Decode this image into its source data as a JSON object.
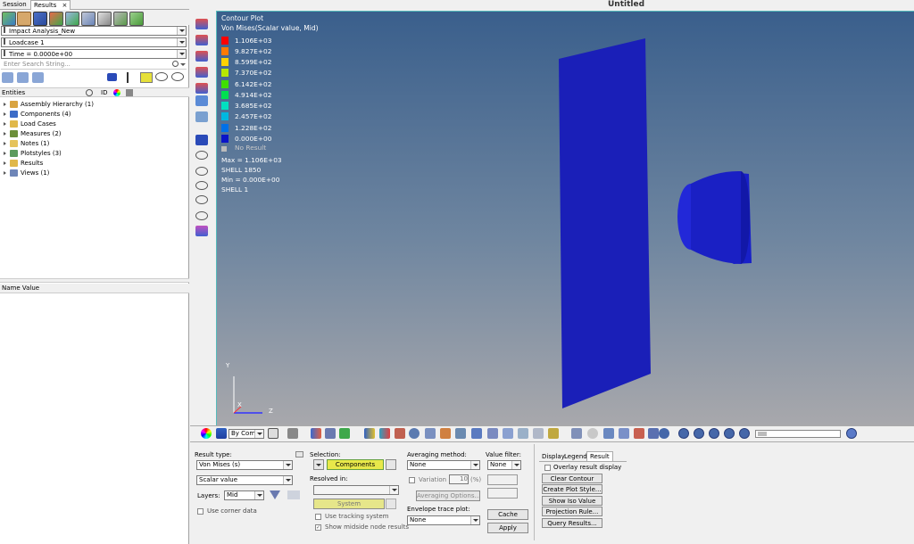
{
  "window": {
    "title": "Untitled"
  },
  "tabs": [
    {
      "label": "Session"
    },
    {
      "label": "Results"
    }
  ],
  "tab_close": "×",
  "dropdowns": {
    "model": "Impact Analysis_New",
    "loadcase": "Loadcase 1",
    "time": "Time = 0.0000e+00"
  },
  "search": {
    "placeholder": "Enter Search String..."
  },
  "entities": {
    "header": "Entities",
    "id_header": "ID"
  },
  "tree": [
    {
      "label": "Assembly Hierarchy (1)",
      "color": "#d9a441"
    },
    {
      "label": "Components (4)",
      "color": "#3c6cc8"
    },
    {
      "label": "Load Cases",
      "color": "#e0b84a"
    },
    {
      "label": "Measures (2)",
      "color": "#6c8f3a"
    },
    {
      "label": "Notes (1)",
      "color": "#e5c35b"
    },
    {
      "label": "Plotstyles (3)",
      "color": "#5d9b5d"
    },
    {
      "label": "Results",
      "color": "#e0b84a"
    },
    {
      "label": "Views (1)",
      "color": "#6f86b8"
    }
  ],
  "name_value_header": "Name Value",
  "legend": {
    "title": "Contour Plot",
    "subtitle": "Von Mises(Scalar value, Mid)",
    "levels": [
      {
        "value": "1.106E+03",
        "color": "#ff0000"
      },
      {
        "value": "9.827E+02",
        "color": "#ff7a00"
      },
      {
        "value": "8.599E+02",
        "color": "#ffd200"
      },
      {
        "value": "7.370E+02",
        "color": "#b8e800"
      },
      {
        "value": "6.142E+02",
        "color": "#3fe000"
      },
      {
        "value": "4.914E+02",
        "color": "#00e050"
      },
      {
        "value": "3.685E+02",
        "color": "#00e0c0"
      },
      {
        "value": "2.457E+02",
        "color": "#00b8e0"
      },
      {
        "value": "1.228E+02",
        "color": "#0070e8"
      },
      {
        "value": "0.000E+00",
        "color": "#0a14c8"
      }
    ],
    "no_result": "No Result",
    "max_line": "Max = 1.106E+03",
    "max_elem": "SHELL 1850",
    "min_line": "Min = 0.000E+00",
    "min_elem": "SHELL 1"
  },
  "axes": {
    "y": "Y",
    "x": "X",
    "z": "Z"
  },
  "toolbar": {
    "by_comp": "By Comp"
  },
  "result_panel": {
    "result_type_label": "Result type:",
    "result_type_value": "Von Mises (s)",
    "scalar_value": "Scalar value",
    "layers_label": "Layers:",
    "layers_value": "Mid",
    "use_corner_data": "Use corner data",
    "selection_label": "Selection:",
    "selection_value": "Components",
    "resolved_in_label": "Resolved in:",
    "system_button": "System",
    "use_tracking": "Use tracking system",
    "show_midside": "Show midside node results",
    "averaging_label": "Averaging method:",
    "averaging_value": "None",
    "variation_label": "Variation <",
    "variation_value": "10",
    "variation_unit": "(%)",
    "averaging_options": "Averaging Options...",
    "envelope_label": "Envelope trace plot:",
    "envelope_value": "None",
    "value_filter_label": "Value filter:",
    "value_filter_value": "None",
    "cache_button": "Cache",
    "apply_button": "Apply"
  },
  "display_tabs": [
    {
      "label": "Display"
    },
    {
      "label": "Legend"
    },
    {
      "label": "Result"
    }
  ],
  "overlay_label": "Overlay result display",
  "buttons": [
    "Clear Contour",
    "Create Plot Style...",
    "Show Iso Value",
    "Projection Rule...",
    "Query Results..."
  ]
}
